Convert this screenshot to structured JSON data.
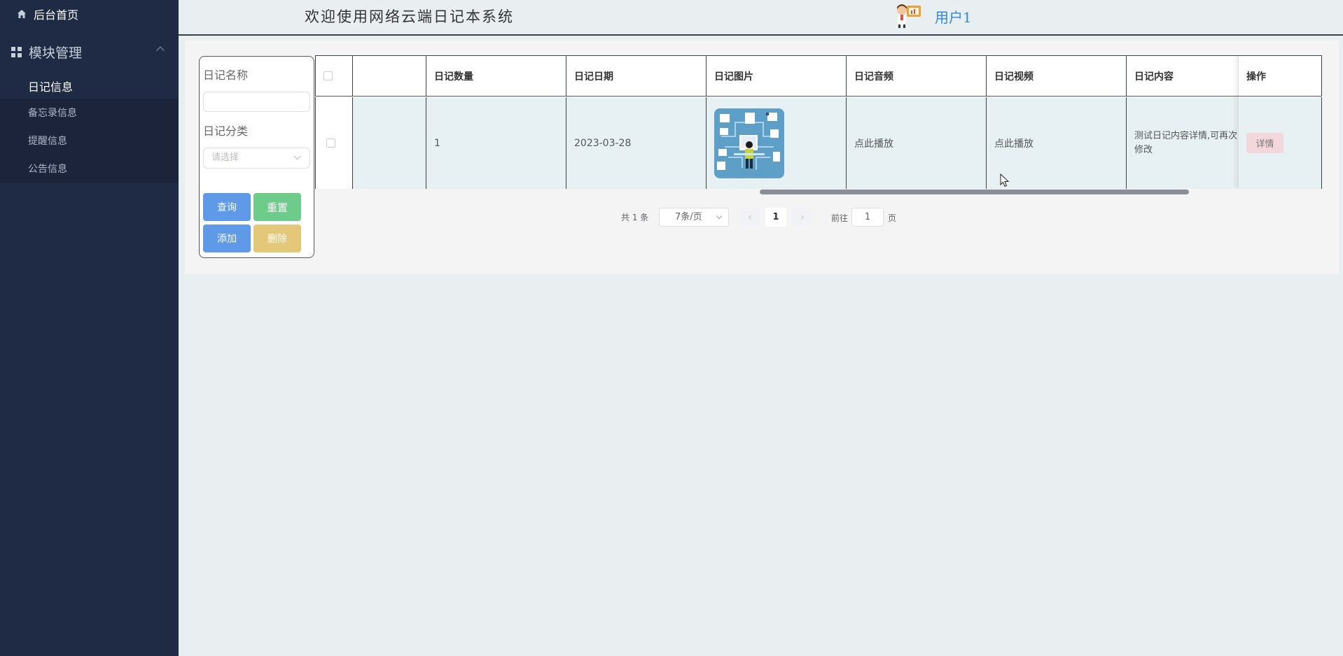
{
  "sidebar": {
    "home_label": "后台首页",
    "module_label": "模块管理",
    "items": [
      {
        "label": "日记信息",
        "active": true
      },
      {
        "label": "备忘录信息",
        "active": false
      },
      {
        "label": "提醒信息",
        "active": false
      },
      {
        "label": "公告信息",
        "active": false
      }
    ]
  },
  "header": {
    "welcome": "欢迎使用网络云端日记本系统",
    "username": "用户1"
  },
  "filter": {
    "name_label": "日记名称",
    "name_value": "",
    "category_label": "日记分类",
    "category_placeholder": "请选择",
    "buttons": {
      "search": "查询",
      "reset": "重置",
      "add": "添加",
      "delete": "删除"
    }
  },
  "table": {
    "columns": [
      "",
      "",
      "日记数量",
      "日记日期",
      "日记图片",
      "日记音频",
      "日记视频",
      "日记内容",
      "操作"
    ],
    "rows": [
      {
        "count": "1",
        "date": "2023-03-28",
        "audio": "点此播放",
        "video": "点此播放",
        "content": "测试日记内容详情,可再次修改",
        "content_visible": "测试日记内容详情,可再\n改",
        "action": "详情"
      }
    ]
  },
  "pagination": {
    "total": "共 1 条",
    "page_size": "7条/页",
    "current_page": "1",
    "goto_label": "前往",
    "goto_value": "1",
    "page_suffix": "页"
  },
  "colors": {
    "sidebar_bg": "#1f2a44",
    "accent_blue": "#5e9ae8",
    "accent_green": "#6dcc8a",
    "accent_yellow": "#e2c878",
    "username_color": "#2e8ad8"
  }
}
